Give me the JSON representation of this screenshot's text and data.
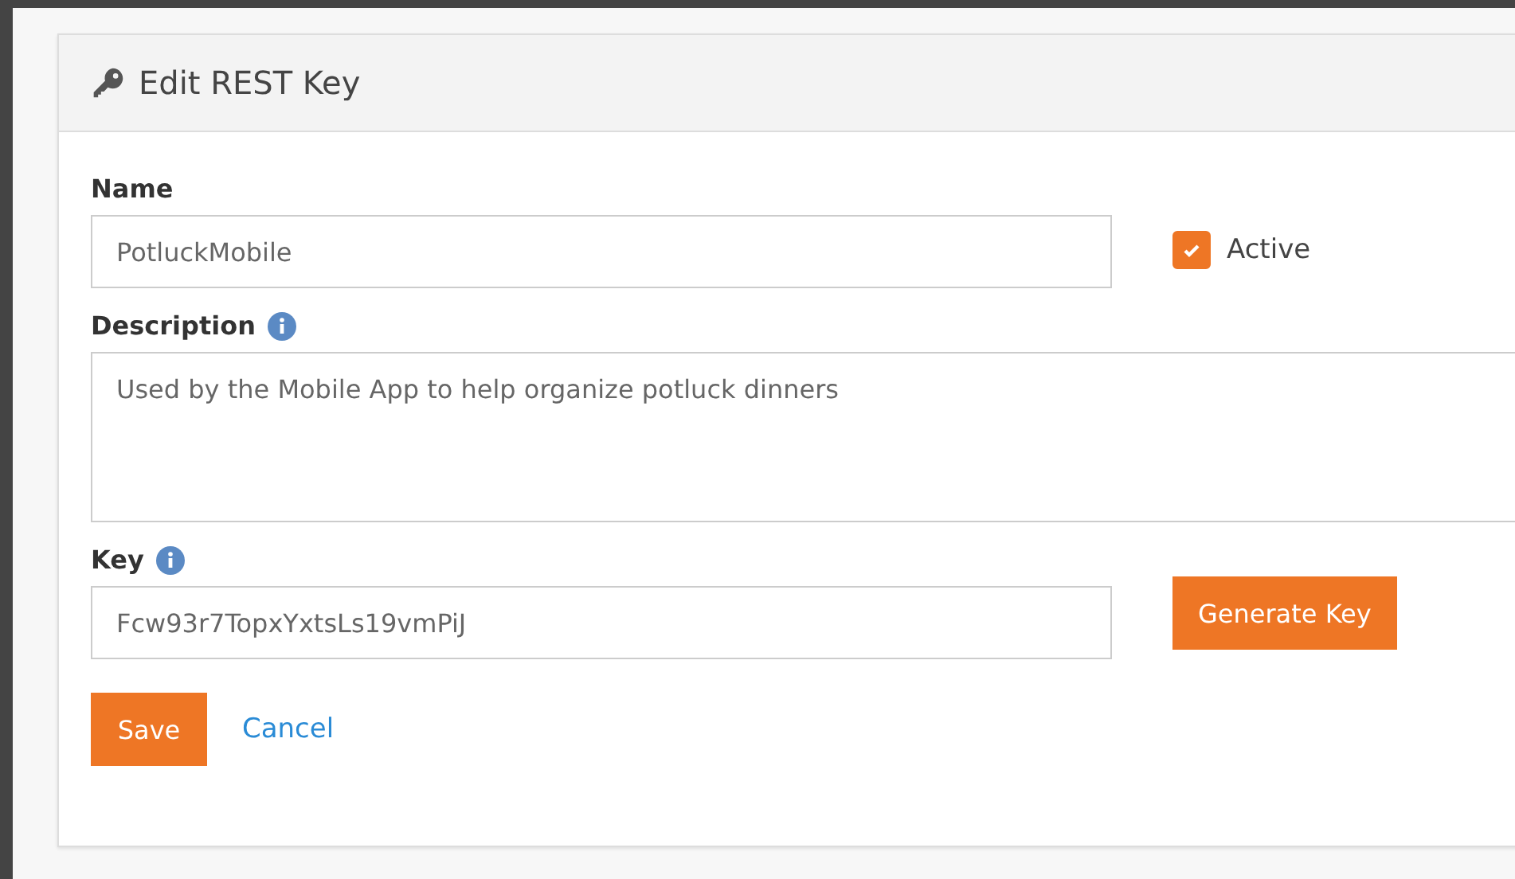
{
  "panel": {
    "title": "Edit REST Key"
  },
  "name_field": {
    "label": "Name",
    "value": "PotluckMobile"
  },
  "active": {
    "label": "Active",
    "checked": true
  },
  "description_field": {
    "label": "Description",
    "value": "Used by the Mobile App to help organize potluck dinners"
  },
  "key_field": {
    "label": "Key",
    "value": "Fcw93r7TopxYxtsLs19vmPiJ"
  },
  "generate_button": "Generate Key",
  "save_button": "Save",
  "cancel_link": "Cancel"
}
